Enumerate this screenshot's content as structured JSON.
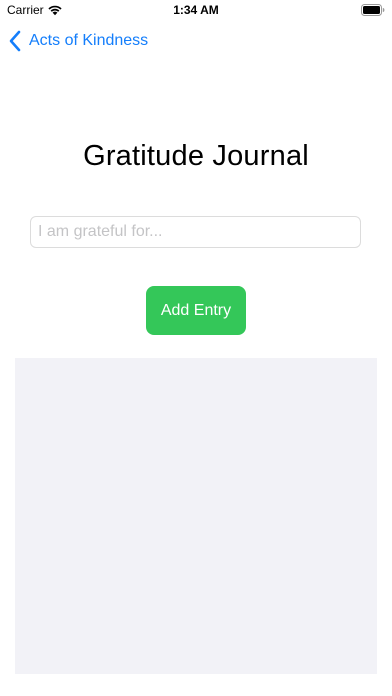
{
  "status_bar": {
    "carrier": "Carrier",
    "time": "1:34 AM",
    "icons": [
      "wifi-icon",
      "battery-icon"
    ]
  },
  "nav": {
    "back_label": "Acts of Kindness",
    "back_icon": "chevron-left-icon"
  },
  "main": {
    "title": "Gratitude Journal",
    "entry_input": {
      "value": "",
      "placeholder": "I am grateful for..."
    },
    "add_button_label": "Add Entry",
    "entries": []
  },
  "colors": {
    "accent": "#147EFB",
    "button": "#34C759",
    "list_background": "#F2F2F7"
  }
}
